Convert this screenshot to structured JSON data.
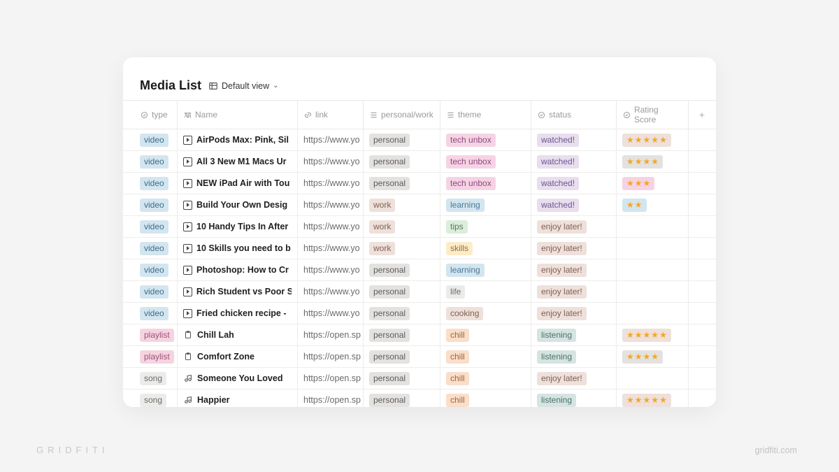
{
  "title": "Media List",
  "view": {
    "label": "Default view"
  },
  "columns": {
    "type": "type",
    "name": "Name",
    "link": "link",
    "pw": "personal/work",
    "theme": "theme",
    "status": "status",
    "rating": "Rating Score",
    "plus": "+"
  },
  "tag_colors": {
    "type": {
      "video": "tag-blue",
      "playlist": "tag-pink",
      "song": "tag-graylt"
    },
    "pw": {
      "personal": "tag-gray",
      "work": "tag-brown"
    },
    "theme": {
      "tech unbox": "tag-pinkish",
      "learning": "tag-bluel",
      "tips": "tag-green",
      "skills": "tag-yellow",
      "life": "tag-graylt",
      "cooking": "tag-brown",
      "chill": "tag-orangel"
    },
    "status": {
      "watched!": "tag-purple",
      "enjoy later!": "tag-brown",
      "listening": "tag-tealish"
    }
  },
  "rows": [
    {
      "type": "video",
      "icon": "play",
      "name": "AirPods Max: Pink, Sil",
      "link": "https://www.yo",
      "pw": "personal",
      "theme": "tech unbox",
      "status": "watched!",
      "rating": 5,
      "rating_bg": "stars-bg-brown"
    },
    {
      "type": "video",
      "icon": "play",
      "name": "All 3 New M1 Macs Ur",
      "link": "https://www.yo",
      "pw": "personal",
      "theme": "tech unbox",
      "status": "watched!",
      "rating": 4,
      "rating_bg": "stars-bg-gray"
    },
    {
      "type": "video",
      "icon": "play",
      "name": "NEW iPad Air with Tou",
      "link": "https://www.yo",
      "pw": "personal",
      "theme": "tech unbox",
      "status": "watched!",
      "rating": 3,
      "rating_bg": "stars-bg-pink"
    },
    {
      "type": "video",
      "icon": "play",
      "name": "Build Your Own Desig",
      "link": "https://www.yo",
      "pw": "work",
      "theme": "learning",
      "status": "watched!",
      "rating": 2,
      "rating_bg": "stars-bg-blue"
    },
    {
      "type": "video",
      "icon": "play",
      "name": "10 Handy Tips In After",
      "link": "https://www.yo",
      "pw": "work",
      "theme": "tips",
      "status": "enjoy later!",
      "rating": 0,
      "rating_bg": ""
    },
    {
      "type": "video",
      "icon": "play",
      "name": "10 Skills you need to b",
      "link": "https://www.yo",
      "pw": "work",
      "theme": "skills",
      "status": "enjoy later!",
      "rating": 0,
      "rating_bg": ""
    },
    {
      "type": "video",
      "icon": "play",
      "name": "Photoshop: How to Cr",
      "link": "https://www.yo",
      "pw": "personal",
      "theme": "learning",
      "status": "enjoy later!",
      "rating": 0,
      "rating_bg": ""
    },
    {
      "type": "video",
      "icon": "play",
      "name": "Rich Student vs Poor S",
      "link": "https://www.yo",
      "pw": "personal",
      "theme": "life",
      "status": "enjoy later!",
      "rating": 0,
      "rating_bg": ""
    },
    {
      "type": "video",
      "icon": "play",
      "name": "Fried chicken recipe -",
      "link": "https://www.yo",
      "pw": "personal",
      "theme": "cooking",
      "status": "enjoy later!",
      "rating": 0,
      "rating_bg": ""
    },
    {
      "type": "playlist",
      "icon": "clip",
      "name": "Chill Lah",
      "link": "https://open.sp",
      "pw": "personal",
      "theme": "chill",
      "status": "listening",
      "rating": 5,
      "rating_bg": "stars-bg-brown"
    },
    {
      "type": "playlist",
      "icon": "clip",
      "name": "Comfort Zone",
      "link": "https://open.sp",
      "pw": "personal",
      "theme": "chill",
      "status": "listening",
      "rating": 4,
      "rating_bg": "stars-bg-gray"
    },
    {
      "type": "song",
      "icon": "music",
      "name": "Someone You Loved",
      "link": "https://open.sp",
      "pw": "personal",
      "theme": "chill",
      "status": "enjoy later!",
      "rating": 0,
      "rating_bg": ""
    },
    {
      "type": "song",
      "icon": "music",
      "name": "Happier",
      "link": "https://open.sp",
      "pw": "personal",
      "theme": "chill",
      "status": "listening",
      "rating": 5,
      "rating_bg": "stars-bg-brown"
    }
  ],
  "watermark": {
    "left": "GRIDFITI",
    "right": "gridfiti.com"
  }
}
